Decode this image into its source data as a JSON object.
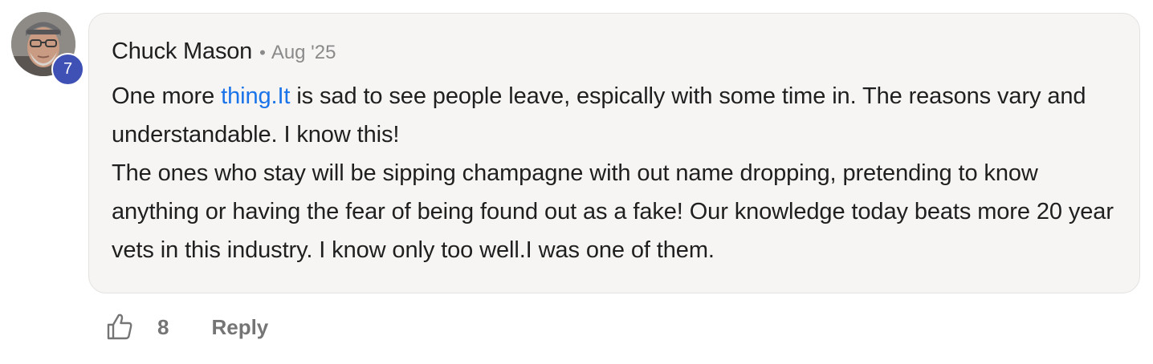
{
  "comment": {
    "author": "Chuck Mason",
    "separator": "•",
    "date": "Aug '25",
    "level": "7",
    "body": {
      "line1_before_link": "One more ",
      "link_text": "thing.It",
      "line1_after_link": " is sad to see people leave, espically with some time in. The reasons vary and understandable. I know this!",
      "paragraph2": "The ones who stay will be sipping champagne with out name dropping, pretending to know anything or having the fear of being found out as a fake! Our knowledge today beats more 20 year vets in this industry. I know only too well.I was one of them."
    },
    "actions": {
      "like_icon": "thumbs-up-icon",
      "like_count": "8",
      "reply_label": "Reply"
    }
  },
  "colors": {
    "bubble_background": "#f6f5f4",
    "badge": "#3f51b5",
    "link": "#1a73e8",
    "muted_text": "#757575"
  }
}
